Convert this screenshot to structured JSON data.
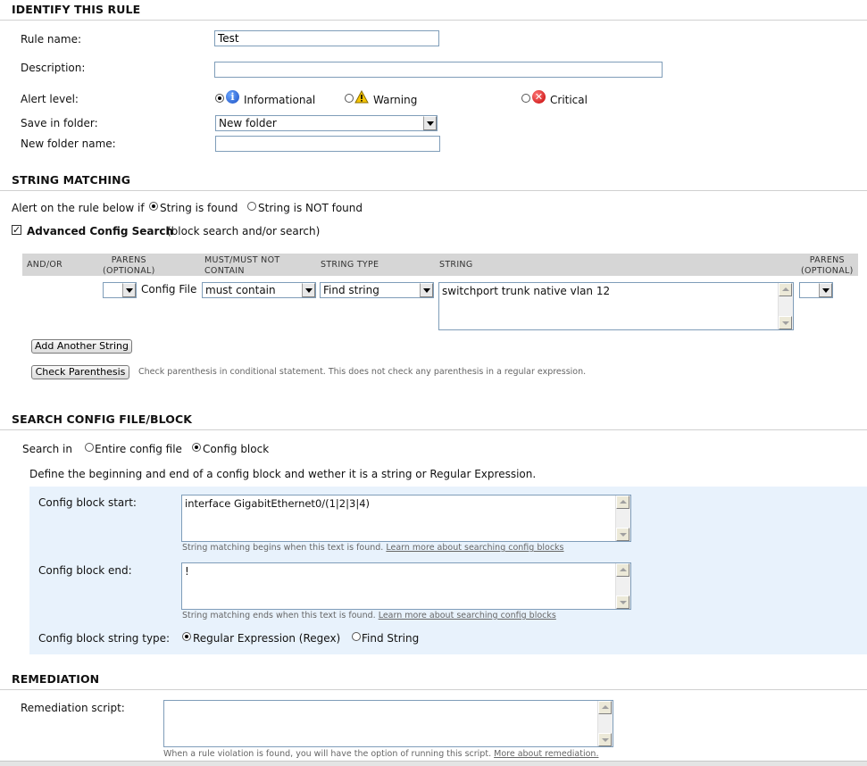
{
  "identify": {
    "title": "IDENTIFY THIS RULE",
    "rule_name_label": "Rule name:",
    "rule_name_value": "Test",
    "description_label": "Description:",
    "description_value": "",
    "alert_level_label": "Alert level:",
    "alert_options": [
      "Informational",
      "Warning",
      "Critical"
    ],
    "alert_selected": "Informational",
    "save_folder_label": "Save in folder:",
    "save_folder_value": "New folder",
    "new_folder_label": "New folder name:",
    "new_folder_value": ""
  },
  "string_matching": {
    "title": "STRING MATCHING",
    "alert_rule_label": "Alert on the rule below if",
    "option_found": "String is found",
    "option_not_found": "String is NOT found",
    "advanced_label": "Advanced Config Search",
    "advanced_sub": "(block search and/or search)",
    "advanced_checked": true,
    "headers": {
      "andor": "AND/OR",
      "parens_open_1": "PARENS",
      "parens_open_2": "(OPTIONAL)",
      "must_1": "MUST/MUST NOT",
      "must_2": "CONTAIN",
      "string_type": "STRING TYPE",
      "string": "STRING",
      "parens_close_1": "PARENS",
      "parens_close_2": "(OPTIONAL)"
    },
    "row": {
      "parens_open_value": "",
      "scope": "Config File",
      "must_value": "must contain",
      "string_type_value": "Find string",
      "string_value": "switchport trunk native vlan 12",
      "parens_close_value": ""
    },
    "add_button": "Add Another String",
    "check_button": "Check Parenthesis",
    "check_help": "Check parenthesis in conditional statement. This does not check any parenthesis in a regular expression."
  },
  "search_config": {
    "title": "SEARCH CONFIG FILE/BLOCK",
    "search_in_label": "Search in",
    "option_entire": "Entire config file",
    "option_block": "Config block",
    "selected": "Config block",
    "define_text": "Define the beginning and end of a config block and wether it is a string or Regular Expression.",
    "block_start_label": "Config block start:",
    "block_start_value": "interface GigabitEthernet0/(1|2|3|4)",
    "block_start_help": "String matching begins when this text is found.",
    "block_end_label": "Config block end:",
    "block_end_value": "!",
    "block_end_help": "String matching ends when this text is found.",
    "learn_more": "Learn more about searching config blocks",
    "type_label": "Config block string type:",
    "type_regex": "Regular Expression (Regex)",
    "type_find": "Find String",
    "type_selected": "Regular Expression (Regex)"
  },
  "remediation": {
    "title": "REMEDIATION",
    "script_label": "Remediation script:",
    "script_value": "",
    "help": "When a rule violation is found, you will have the option of running this script.",
    "more_link": "More about remediation."
  },
  "colors": {
    "block_panel_bg": "#e8f2fc",
    "table_header_bg": "#d6d6d6",
    "input_border": "#7f9db9"
  }
}
